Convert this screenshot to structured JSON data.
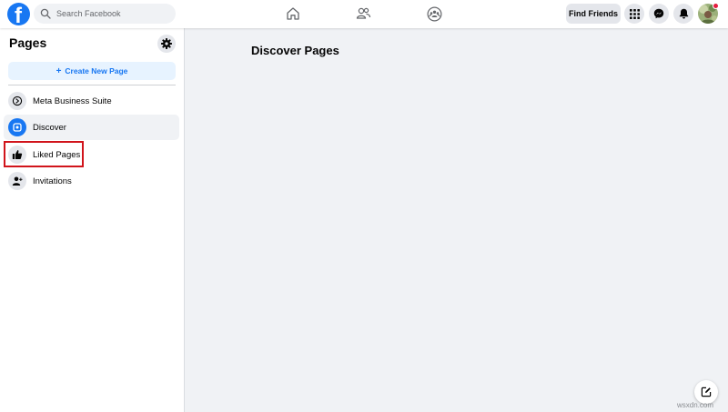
{
  "header": {
    "search": {
      "placeholder": "Search Facebook",
      "value": ""
    },
    "find_friends_label": "Find Friends",
    "brand_color": "#1877f2",
    "nav_icons": [
      "home-icon",
      "friends-icon",
      "groups-icon"
    ],
    "right_icons": [
      "menu-grid-icon",
      "messenger-icon",
      "notifications-icon"
    ],
    "notification_dot_color": "#e41e3f"
  },
  "sidebar": {
    "title": "Pages",
    "create_label": "Create New Page",
    "items": [
      {
        "label": "Meta Business Suite",
        "icon": "business-suite-icon",
        "active": false
      },
      {
        "label": "Discover",
        "icon": "discover-icon",
        "active": true
      },
      {
        "label": "Liked Pages",
        "icon": "thumbs-up-icon",
        "active": false,
        "highlighted": true
      },
      {
        "label": "Invitations",
        "icon": "invite-person-icon",
        "active": false
      }
    ]
  },
  "main": {
    "title": "Discover Pages"
  },
  "watermark": "wsxdn.com"
}
